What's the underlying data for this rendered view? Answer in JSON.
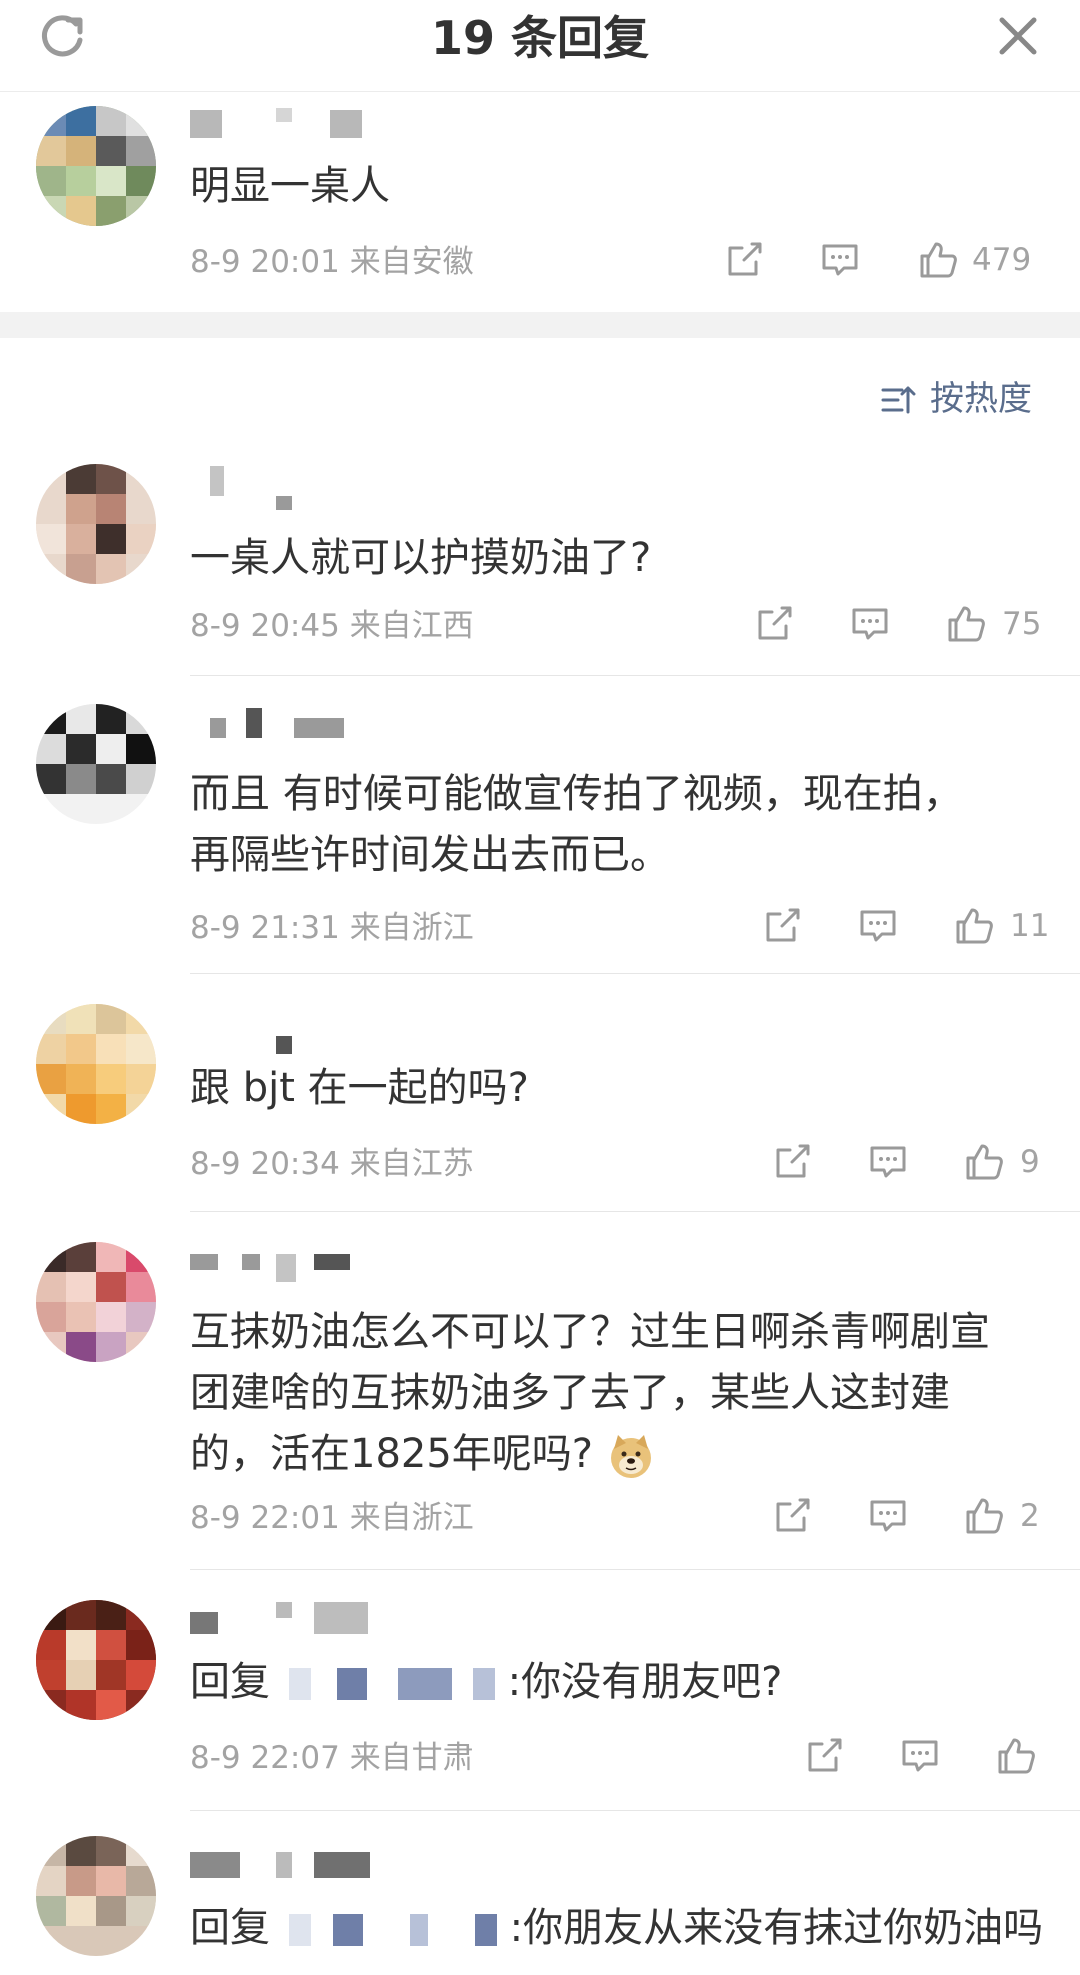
{
  "header": {
    "title": "19 条回复",
    "refresh_icon": "refresh-icon",
    "close_icon": "close-icon"
  },
  "root_comment": {
    "text": "明显一桌人",
    "time": "8-9 20:01",
    "location": "来自安徽",
    "likes": "479"
  },
  "sort": {
    "label": "按热度",
    "icon": "sort-icon"
  },
  "replies": [
    {
      "text": "一桌人就可以护摸奶油了?",
      "time": "8-9 20:45",
      "location": "来自江西",
      "likes": "75"
    },
    {
      "text_line1": "而且 有时候可能做宣传拍了视频，现在拍，",
      "text_line2": "再隔些许时间发出去而已。",
      "time": "8-9 21:31",
      "location": "来自浙江",
      "likes": "11"
    },
    {
      "text": "跟 bjt 在一起的吗?",
      "time": "8-9 20:34",
      "location": "来自江苏",
      "likes": "9"
    },
    {
      "text_line1": "互抹奶油怎么不可以了？过生日啊杀青啊剧宣",
      "text_line2": "团建啥的互抹奶油多了去了，某些人这封建",
      "text_line3": "的，活在1825年呢吗?",
      "emoji": "doge-emoji",
      "time": "8-9 22:01",
      "location": "来自浙江",
      "likes": "2"
    },
    {
      "prefix": "回复",
      "suffix": ":你没有朋友吧?",
      "time": "8-9 22:07",
      "location": "来自甘肃",
      "likes": ""
    },
    {
      "prefix": "回复",
      "suffix": ":你朋友从来没有抹过你奶油吗"
    }
  ],
  "icons": {
    "share": "share-icon",
    "comment": "comment-icon",
    "like": "like-icon"
  }
}
